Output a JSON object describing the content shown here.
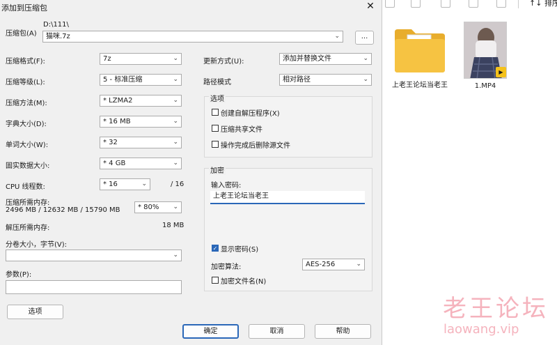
{
  "dialog": {
    "title": "添加到压缩包",
    "close_glyph": "✕",
    "archive_label": "压缩包(A)",
    "archive_path": "D:\\111\\",
    "archive_name": "猫咪.7z",
    "browse_label": "...",
    "left": {
      "format_label": "压缩格式(F):",
      "format_value": "7z",
      "level_label": "压缩等级(L):",
      "level_value": "5 - 标准压缩",
      "method_label": "压缩方法(M):",
      "method_value": "* LZMA2",
      "dict_label": "字典大小(D):",
      "dict_value": "* 16 MB",
      "word_label": "单词大小(W):",
      "word_value": "* 32",
      "solid_label": "固实数据大小:",
      "solid_value": "* 4 GB",
      "threads_label": "CPU 线程数:",
      "threads_value": "* 16",
      "threads_total": "/ 16",
      "mem_comp_label": "压缩所需内存:",
      "mem_comp_detail": "2496 MB / 12632 MB / 15790 MB",
      "mem_comp_value": "* 80%",
      "mem_decomp_label": "解压所需内存:",
      "mem_decomp_value": "18 MB",
      "split_label": "分卷大小，字节(V):",
      "split_value": "",
      "params_label": "参数(P):",
      "params_value": "",
      "options_button": "选项"
    },
    "right": {
      "update_label": "更新方式(U):",
      "update_value": "添加并替换文件",
      "pathmode_label": "路径模式",
      "pathmode_value": "相对路径",
      "options_group": "选项",
      "opt_sfx": "创建自解压程序(X)",
      "opt_shared": "压缩共享文件",
      "opt_delete": "操作完成后删除源文件",
      "encrypt_group": "加密",
      "password_label": "输入密码:",
      "password_value": "上老王论坛当老王",
      "show_password": "显示密码(S)",
      "show_password_checked": true,
      "enc_method_label": "加密算法:",
      "enc_method_value": "AES-256",
      "encrypt_names": "加密文件名(N)"
    },
    "buttons": {
      "ok": "确定",
      "cancel": "取消",
      "help": "帮助"
    }
  },
  "explorer": {
    "toolbar_sort": "排序",
    "items": [
      {
        "name": "上老王论坛当老王",
        "type": "folder"
      },
      {
        "name": "1.MP4",
        "type": "video"
      }
    ]
  },
  "watermark": {
    "cn": "老王论坛",
    "en": "laowang.vip"
  },
  "colors": {
    "accent": "#2a67b8",
    "folder": "#f6c342",
    "watermark": "#f5b3bd"
  }
}
